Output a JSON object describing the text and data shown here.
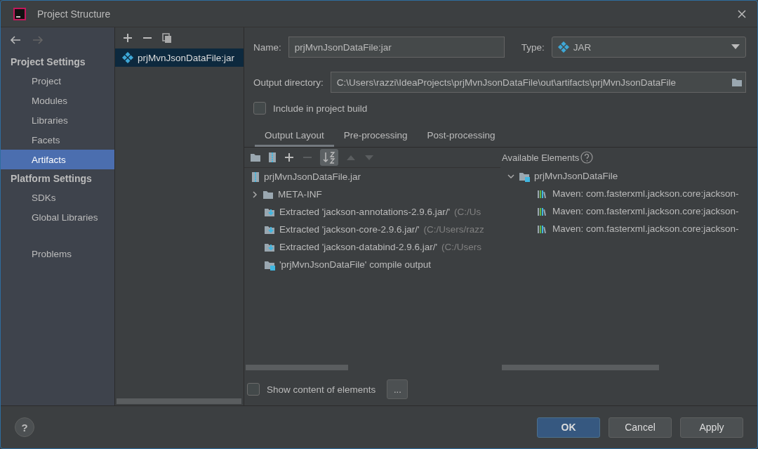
{
  "window": {
    "title": "Project Structure"
  },
  "toolbar_nav": {
    "back_disabled": false,
    "forward_disabled": true
  },
  "sidebar": {
    "sections": [
      {
        "heading": "Project Settings",
        "items": [
          {
            "label": "Project",
            "selected": false
          },
          {
            "label": "Modules",
            "selected": false
          },
          {
            "label": "Libraries",
            "selected": false
          },
          {
            "label": "Facets",
            "selected": false
          },
          {
            "label": "Artifacts",
            "selected": true
          }
        ]
      },
      {
        "heading": "Platform Settings",
        "items": [
          {
            "label": "SDKs",
            "selected": false
          },
          {
            "label": "Global Libraries",
            "selected": false
          }
        ]
      },
      {
        "items": [
          {
            "label": "Problems",
            "selected": false
          }
        ]
      }
    ]
  },
  "artifacts": [
    {
      "label": "prjMvnJsonDataFile:jar",
      "selected": true
    }
  ],
  "form": {
    "name_label": "Name:",
    "name_value": "prjMvnJsonDataFile:jar",
    "type_label": "Type:",
    "type_value": "JAR",
    "output_label": "Output directory:",
    "output_value": "C:\\Users\\razzi\\IdeaProjects\\prjMvnJsonDataFile\\out\\artifacts\\prjMvnJsonDataFile",
    "include_label": "Include in project build",
    "include_checked": false
  },
  "tabs": [
    {
      "label": "Output Layout",
      "selected": true
    },
    {
      "label": "Pre-processing",
      "selected": false
    },
    {
      "label": "Post-processing",
      "selected": false
    }
  ],
  "output_layout": {
    "root": {
      "label": "prjMvnJsonDataFile.jar",
      "children": [
        {
          "kind": "folder",
          "label": "META-INF",
          "expanded": false
        },
        {
          "kind": "extracted",
          "label": "Extracted 'jackson-annotations-2.9.6.jar/'",
          "hint": "(C:/Us"
        },
        {
          "kind": "extracted",
          "label": "Extracted 'jackson-core-2.9.6.jar/'",
          "hint": "(C:/Users/razz"
        },
        {
          "kind": "extracted",
          "label": "Extracted 'jackson-databind-2.9.6.jar/'",
          "hint": "(C:/Users"
        },
        {
          "kind": "module",
          "label": "'prjMvnJsonDataFile' compile output"
        }
      ]
    }
  },
  "available": {
    "title": "Available Elements",
    "tree": [
      {
        "label": "prjMvnJsonDataFile",
        "expanded": true,
        "children": [
          {
            "label": "Maven: com.fasterxml.jackson.core:jackson-"
          },
          {
            "label": "Maven: com.fasterxml.jackson.core:jackson-"
          },
          {
            "label": "Maven: com.fasterxml.jackson.core:jackson-"
          }
        ]
      }
    ]
  },
  "show_content": {
    "label": "Show content of elements",
    "checked": false,
    "button": "..."
  },
  "buttons": [
    {
      "label": "OK",
      "kind": "primary"
    },
    {
      "label": "Cancel",
      "kind": "normal"
    },
    {
      "label": "Apply",
      "kind": "normal"
    }
  ],
  "help": "?"
}
